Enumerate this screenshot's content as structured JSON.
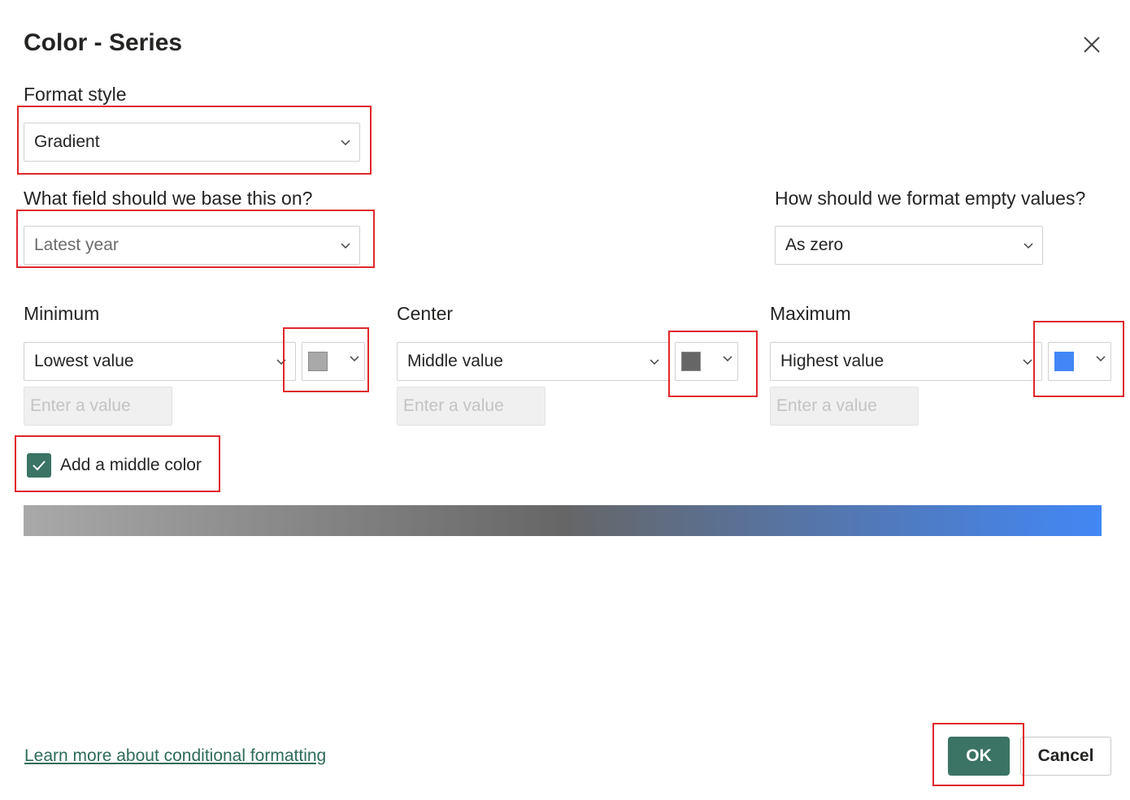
{
  "dialog": {
    "title": "Color - Series"
  },
  "format_style": {
    "label": "Format style",
    "value": "Gradient"
  },
  "base_field": {
    "label": "What field should we base this on?",
    "value": "Latest year"
  },
  "empty_values": {
    "label": "How should we format empty values?",
    "value": "As zero"
  },
  "minimum": {
    "label": "Minimum",
    "value": "Lowest value",
    "placeholder": "Enter a value",
    "color": "#a9a9a9"
  },
  "center": {
    "label": "Center",
    "value": "Middle value",
    "placeholder": "Enter a value",
    "color": "#666666"
  },
  "maximum": {
    "label": "Maximum",
    "value": "Highest value",
    "placeholder": "Enter a value",
    "color": "#4287f5"
  },
  "middle_color": {
    "label": "Add a middle color",
    "checked": true
  },
  "footer": {
    "link": "Learn more about conditional formatting",
    "ok": "OK",
    "cancel": "Cancel"
  },
  "icons": {
    "close": "close-icon",
    "chevron": "chevron-down-icon",
    "check": "checkmark-icon"
  },
  "highlight_color": "#e0262b",
  "accent_color": "#3b7364"
}
